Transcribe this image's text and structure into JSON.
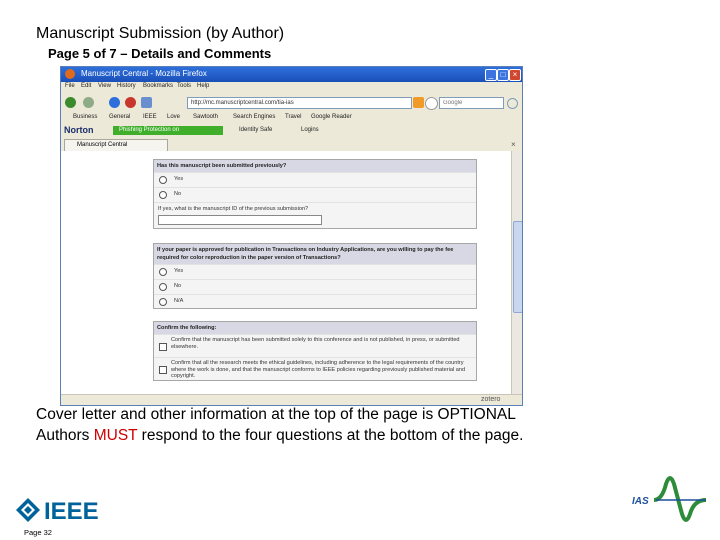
{
  "slide": {
    "title": "Manuscript Submission (by Author)",
    "subtitle": "Page 5 of 7 – Details and Comments",
    "caption_line1": "Cover letter and other information at the top of the page is OPTIONAL",
    "caption_line2_prefix": "Authors ",
    "caption_line2_emph": "MUST",
    "caption_line2_suffix": " respond to the four questions at the bottom of the page.",
    "page_number": "Page 32",
    "ieee_logo_text": "IEEE",
    "ias_logo_text": "IAS",
    "accent_red": "#cc0000"
  },
  "browser": {
    "window_title": "Manuscript Central - Mozilla Firefox",
    "menu": [
      "File",
      "Edit",
      "View",
      "History",
      "Bookmarks",
      "Tools",
      "Help"
    ],
    "address": "http://mc.manuscriptcentral.com/tia-ias",
    "search_placeholder": "Google",
    "bookmarks": [
      "Business",
      "General",
      "IEEE",
      "Love",
      "Sawtooth",
      "Search Engines",
      "Travel",
      "Google Reader"
    ],
    "norton": {
      "brand": "Norton",
      "phishing": "Phishing Protection on",
      "identity": "Identity Safe",
      "logins": "Logins"
    },
    "tab_label": "Manuscript Central",
    "status_right": "zotero",
    "icons": [
      "back-arrow-icon",
      "forward-arrow-icon",
      "refresh-icon",
      "stop-icon",
      "home-icon",
      "rss-icon",
      "google-icon"
    ]
  },
  "form": {
    "q1": {
      "question": "Has this manuscript been submitted previously?",
      "options": [
        "Yes",
        "No"
      ],
      "followup": "If yes, what is the manuscript ID of the previous submission?",
      "followup_value": ""
    },
    "q2": {
      "question": "If your paper is approved for publication in Transactions on Industry Applications, are you willing to pay the fee required for color reproduction in the paper version of Transactions?",
      "options": [
        "Yes",
        "No",
        "N/A"
      ]
    },
    "confirm": {
      "heading": "Confirm the following:",
      "items": [
        "Confirm that the manuscript has been submitted solely to this conference and is not published, in press, or submitted elsewhere.",
        "Confirm that all the research meets the ethical guidelines, including adherence to the legal requirements of the country where the work is done, and that the manuscript conforms to IEEE policies regarding previously published material and copyright."
      ]
    }
  }
}
